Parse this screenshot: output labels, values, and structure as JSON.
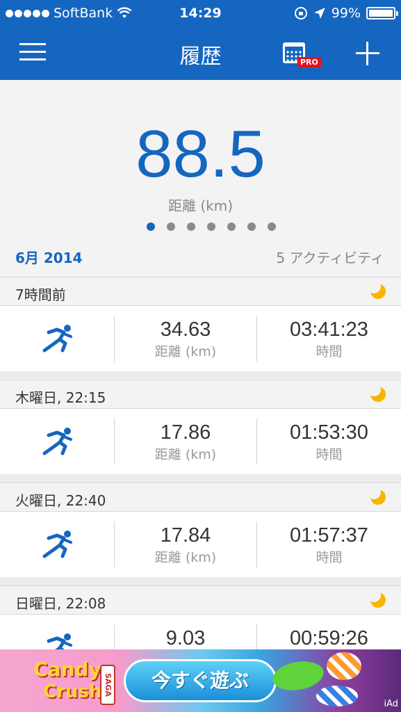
{
  "status_bar": {
    "carrier": "SoftBank",
    "time": "14:29",
    "battery": "99%",
    "battery_level": 0.99
  },
  "nav": {
    "title": "履歴",
    "calendar_badge": "PRO"
  },
  "summary": {
    "value": "88.5",
    "label": "距離 (km)",
    "page_count": 7,
    "active_page": 1,
    "month": "6月 2014",
    "activity_count": "5 アクティビティ"
  },
  "labels": {
    "distance": "距離 (km)",
    "duration": "時間"
  },
  "activities": [
    {
      "when": "7時間前",
      "distance": "34.63",
      "duration": "03:41:23"
    },
    {
      "when": "木曜日, 22:15",
      "distance": "17.86",
      "duration": "01:53:30"
    },
    {
      "when": "火曜日, 22:40",
      "distance": "17.84",
      "duration": "01:57:37"
    },
    {
      "when": "日曜日, 22:08",
      "distance": "9.03",
      "duration": "00:59:26"
    }
  ],
  "ad": {
    "brand_line1": "Candy",
    "brand_line2": "Crush",
    "brand_tag": "SAGA",
    "cta": "今すぐ遊ぶ",
    "provider": "iAd"
  },
  "colors": {
    "accent": "#1566c0",
    "moon": "#f7b500",
    "pro_badge": "#e0141e"
  }
}
